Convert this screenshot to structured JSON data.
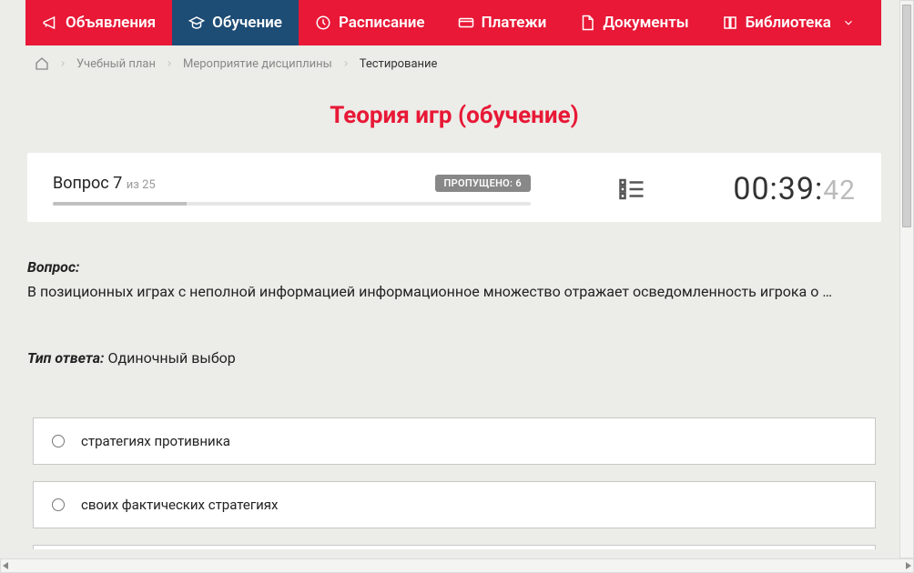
{
  "nav": {
    "items": [
      {
        "label": "Объявления",
        "icon": "megaphone-icon"
      },
      {
        "label": "Обучение",
        "icon": "grad-cap-icon",
        "active": true
      },
      {
        "label": "Расписание",
        "icon": "clock-icon"
      },
      {
        "label": "Платежи",
        "icon": "card-icon"
      },
      {
        "label": "Документы",
        "icon": "doc-icon"
      },
      {
        "label": "Библиотека",
        "icon": "book-icon",
        "hasDropdown": true
      }
    ]
  },
  "breadcrumb": {
    "plan": "Учебный план",
    "event": "Мероприятие дисциплины",
    "current": "Тестирование"
  },
  "page_title": "Теория игр (обучение)",
  "status": {
    "question_label": "Вопрос",
    "question_num": "7",
    "of_label": "из",
    "total": "25",
    "skipped_label": "ПРОПУЩЕНО:",
    "skipped_count": "6",
    "timer_main": "00:39:",
    "timer_sec": "42"
  },
  "question": {
    "label": "Вопрос:",
    "text": "В позиционных играх с неполной информацией информационное множество отражает осведомленность игрока о …",
    "answer_type_label": "Тип ответа:",
    "answer_type": "Одиночный выбор",
    "options": [
      "стратегиях противника",
      "своих фактических стратегиях"
    ]
  }
}
